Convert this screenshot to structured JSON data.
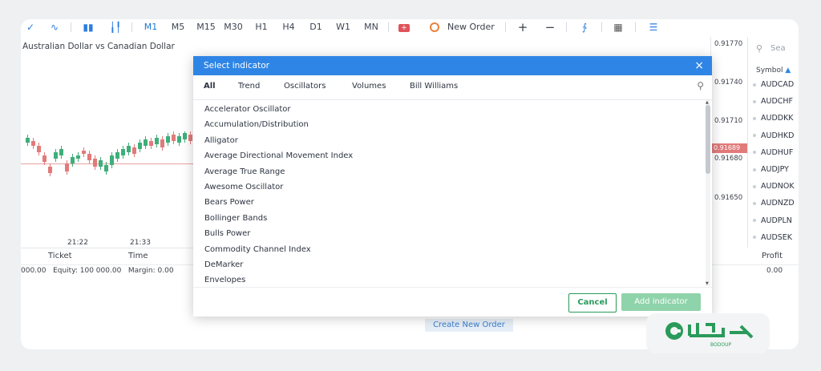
{
  "toolbar": {
    "timeframes": [
      "M1",
      "M5",
      "M15",
      "M30",
      "H1",
      "H4",
      "D1",
      "W1",
      "MN"
    ],
    "active_timeframe": "M1",
    "new_order_label": "New Order",
    "plus_label": "+",
    "minus_label": "−"
  },
  "chart": {
    "symbol_title": "Australian Dollar vs Canadian Dollar",
    "price_labels": [
      "0.91770",
      "0.91740",
      "0.91710",
      "0.91680",
      "0.91650"
    ],
    "current_price": "0.91689",
    "time_labels": [
      "21:22",
      "21:33"
    ],
    "up_color": "#3fae7a",
    "down_color": "#e27a7a"
  },
  "market_watch": {
    "search_placeholder": "Sea",
    "header": "Symbol",
    "symbols": [
      "AUDCAD",
      "AUDCHF",
      "AUDDKK",
      "AUDHKD",
      "AUDHUF",
      "AUDJPY",
      "AUDNOK",
      "AUDNZD",
      "AUDPLN",
      "AUDSEK"
    ]
  },
  "bottom": {
    "columns": [
      "Ticket",
      "Time",
      "Profit"
    ],
    "balance_row": "000.00   Equity: 100 000.00   Margin: 0.00",
    "profit_value": "0.00",
    "create_order_label": "Create New Order"
  },
  "dialog": {
    "title": "Select indicator",
    "close_label": "×",
    "tabs": [
      "All",
      "Trend",
      "Oscillators",
      "Volumes",
      "Bill Williams"
    ],
    "active_tab": "All",
    "indicators": [
      "Accelerator Oscillator",
      "Accumulation/Distribution",
      "Alligator",
      "Average Directional Movement Index",
      "Average True Range",
      "Awesome Oscillator",
      "Bears Power",
      "Bollinger Bands",
      "Bulls Power",
      "Commodity Channel Index",
      "DeMarker",
      "Envelopes"
    ],
    "cancel_label": "Cancel",
    "add_label": "Add indicator"
  },
  "logo": {
    "caption": "BODOUP",
    "brand_color": "#2a9a5b"
  }
}
